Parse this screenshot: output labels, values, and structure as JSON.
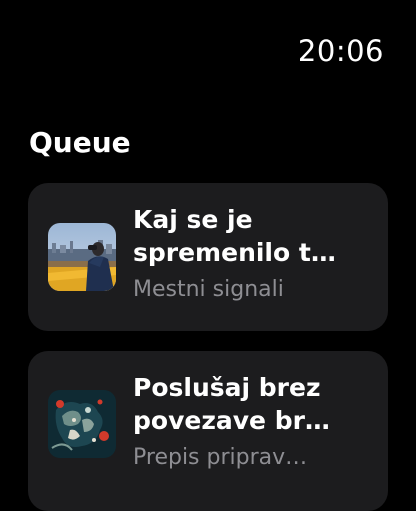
{
  "status_bar": {
    "time": "20:06"
  },
  "queue": {
    "title": "Queue",
    "items": [
      {
        "title": "Kaj se je\nspremenilo t…",
        "subtitle": "Mestni signali",
        "artwork_icon": "city-photographer-artwork"
      },
      {
        "title": "Poslušaj brez\npovezave br…",
        "subtitle": "Prepis priprav…",
        "artwork_icon": "abstract-map-artwork"
      }
    ]
  },
  "colors": {
    "background": "#000000",
    "card": "#1c1c1e",
    "primary_text": "#ffffff",
    "secondary_text": "#8e8e93"
  }
}
